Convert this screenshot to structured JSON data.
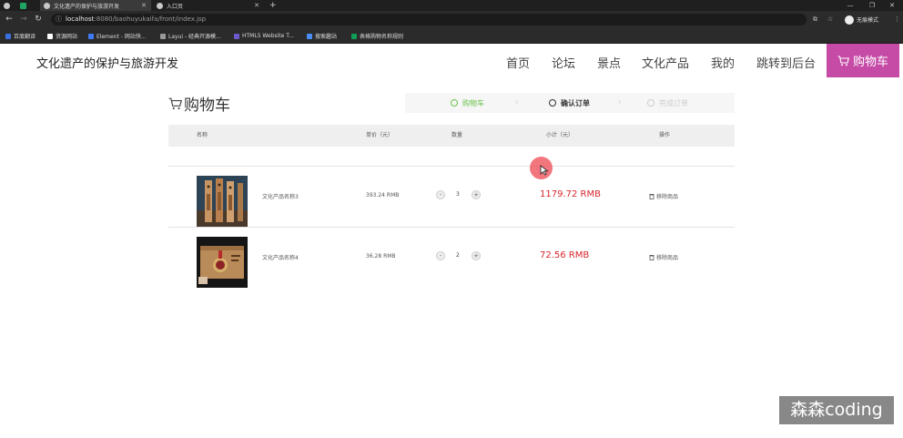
{
  "browser": {
    "tabs": [
      {
        "title": ""
      },
      {
        "title": "文化遗产的保护与旅游开发"
      },
      {
        "title": "入口页"
      }
    ],
    "new_tab": "+",
    "window_controls": [
      "—",
      "❐",
      "✕"
    ],
    "url_host": "localhost",
    "url_path": ":8080/baohuyukaifa/front/index.jsp",
    "incognito_label": "无痕模式",
    "bookmarks": [
      {
        "label": "百度翻译",
        "color": "#3b6fe0"
      },
      {
        "label": "资源网站",
        "color": "#ffffff"
      },
      {
        "label": "Element - 网站快...",
        "color": "#3f7bf5"
      },
      {
        "label": "Layui - 经典开源模...",
        "color": "#9a9a9a"
      },
      {
        "label": "HTML5 Website T...",
        "color": "#6a5acd"
      },
      {
        "label": "搜索趣站",
        "color": "#4a8df8"
      },
      {
        "label": "表格购物名称规则",
        "color": "#0f9d58"
      }
    ]
  },
  "header": {
    "brand": "文化遗产的保护与旅游开发",
    "nav": [
      "首页",
      "论坛",
      "景点",
      "文化产品",
      "我的",
      "跳转到后台"
    ],
    "cart_button": "购物车"
  },
  "cart": {
    "title": "购物车",
    "steps": [
      {
        "label": "购物车",
        "state": "done"
      },
      {
        "label": "确认订单",
        "state": "current"
      },
      {
        "label": "完成订单",
        "state": "pending"
      }
    ],
    "columns": [
      "名称",
      "单价（元）",
      "数量",
      "小计（元）",
      "操作"
    ],
    "items": [
      {
        "name": "文化产品名称3",
        "price": "393.24 RMB",
        "qty": "3",
        "subtotal": "1179.72 RMB",
        "action": "移除商品",
        "image": "bookmark-product"
      },
      {
        "name": "文化产品名称4",
        "price": "36.28 RMB",
        "qty": "2",
        "subtotal": "72.56 RMB",
        "action": "移除商品",
        "image": "medal-box-product"
      }
    ],
    "qty_minus": "-",
    "qty_plus": "+"
  },
  "watermark": "森森coding",
  "colors": {
    "accent": "#c54ba6",
    "step_done": "#6bc24a",
    "subtotal": "#d9252b"
  }
}
